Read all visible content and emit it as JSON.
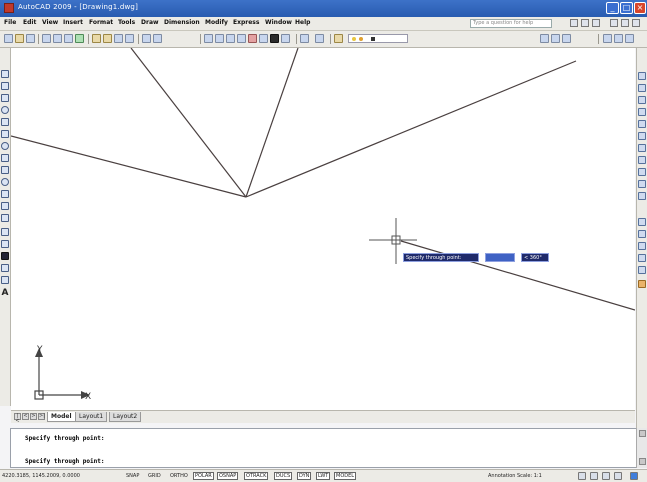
{
  "window": {
    "title": "AutoCAD 2009 - [Drawing1.dwg]",
    "minimize_glyph": "_",
    "maximize_glyph": "□",
    "close_glyph": "×"
  },
  "menu": {
    "items": [
      "File",
      "Edit",
      "View",
      "Insert",
      "Format",
      "Tools",
      "Draw",
      "Dimension",
      "Modify",
      "Express",
      "Window",
      "Help"
    ],
    "search_placeholder": "Type a question for help"
  },
  "drawing": {
    "tooltip_prompt": "Specify through point:",
    "tooltip_angle": "< 360°",
    "ucs_y": "Y",
    "ucs_x": "X"
  },
  "tabs": {
    "items": [
      "Model",
      "Layout1",
      "Layout2"
    ],
    "active": "Model"
  },
  "command": {
    "lines": [
      "Specify through point:",
      "Specify through point:"
    ]
  },
  "status": {
    "coords": "4220.3185, 1145.2009, 0.0000",
    "toggles": [
      "SNAP",
      "GRID",
      "ORTHO",
      "POLAR",
      "OSNAP",
      "OTRACK",
      "DUCS",
      "DYN",
      "LWT",
      "MODEL"
    ],
    "toggles_on": [
      "POLAR",
      "OSNAP",
      "OTRACK",
      "DUCS",
      "DYN",
      "LWT",
      "MODEL"
    ],
    "annotation_scale": "Annotation Scale: 1:1"
  },
  "colors": {
    "titlebar": "#2f63bd",
    "tooltip_bg": "#1f2a6b",
    "canvas": "#ffffff",
    "line": "#4a4040"
  }
}
